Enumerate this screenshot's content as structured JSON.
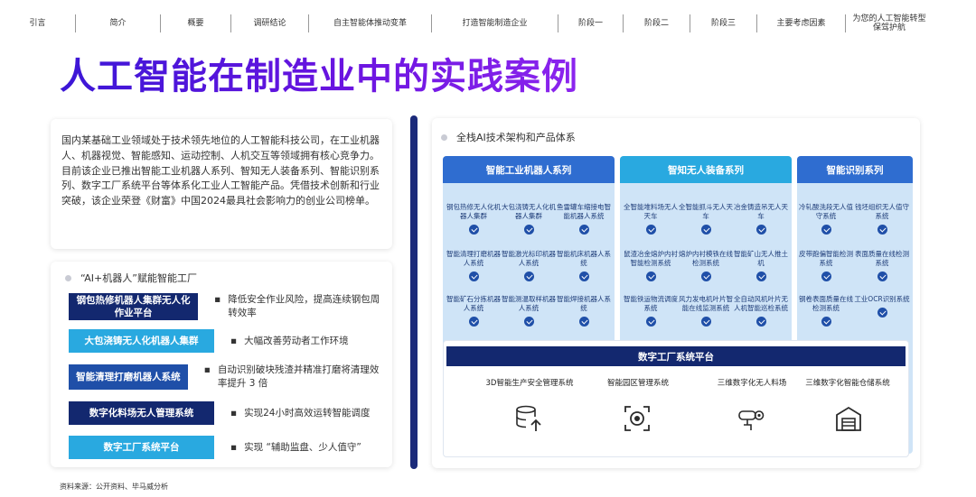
{
  "nav": [
    "引言",
    "简介",
    "概要",
    "调研结论",
    "自主智能体推动变革",
    "打造智能制造企业",
    "阶段一",
    "阶段二",
    "阶段三",
    "主要考虑因素",
    "为您的人工智能转型保驾护航"
  ],
  "title": "人工智能在制造业中的实践案例",
  "intro": "国内某基础工业领域处于技术领先地位的人工智能科技公司，在工业机器人、机器视觉、智能感知、运动控制、人机交互等领域拥有核心竞争力。目前该企业已推出智能工业机器人系列、智知无人装备系列、智能识别系列、数字工厂系统平台等体系化工业人工智能产品。凭借技术创新和行业突破，该企业荣登《财富》中国2024最具社会影响力的创业公司榜单。",
  "factory": {
    "heading": "“AI+机器人”赋能智能工厂",
    "rows": [
      {
        "label": "钢包热修机器人集群无人化作业平台",
        "desc": "降低安全作业风险，提高连续钢包周转效率",
        "color": "#13286f"
      },
      {
        "label": "大包浇铸无人化机器人集群",
        "desc": "大幅改善劳动者工作环境",
        "color": "#29a9e0"
      },
      {
        "label": "智能清理打磨机器人系统",
        "desc": "自动识别破块残渣并精准打磨将清理效率提升 3 倍",
        "color": "#1f4fa8"
      },
      {
        "label": "数字化料场无人管理系统",
        "desc": "实现24小时高效运转智能调度",
        "color": "#13286f"
      },
      {
        "label": "数字工厂系统平台",
        "desc": "实现 “辅助监盘、少人值守”",
        "color": "#29a9e0"
      }
    ]
  },
  "arch": {
    "heading": "全栈AI技术架构和产品体系",
    "panels": [
      {
        "title": "智能工业机器人系列",
        "color": "#2f6dd0",
        "items": [
          "钢包热修无人化机器人集群",
          "大包浇铸无人化机器人集群",
          "鱼雷罐车缩接电智能机器人系统",
          "智能清理打磨机器人系统",
          "智能激光标印机器人系统",
          "智能机床机器人系统",
          "智能矿石分拣机器人系统",
          "智能测温取样机器人系统",
          "智能焊接机器人系统"
        ]
      },
      {
        "title": "智知无人装备系列",
        "color": "#29a9e0",
        "items": [
          "全智能堆料场无人天车",
          "全智能抓斗无人天车",
          "冶金铸造吊无人天车",
          "鼠渣冶金熔炉内衬智能检测系统",
          "熔炉内衬模铁在线检测系统",
          "智能矿山无人推土机",
          "智能铁运物流调度系统",
          "风力发电机叶片智能在线监测系统",
          "全自动风机叶片无人机智能巡检系统"
        ]
      },
      {
        "title": "智能识别系列",
        "color": "#2f6dd0",
        "items": [
          "冷轧酸洗段无人值守系统",
          "钱坯组织无人值守系统",
          "皮带跑偏智能检测系统",
          "表面质量在线检测系统",
          "钢卷表面质量在线检测系统",
          "工业OCR识别系统"
        ]
      }
    ],
    "platform": {
      "title": "数字工厂系统平台",
      "items": [
        "3D智能生产安全管理系统",
        "智能园区管理系统",
        "三维数字化无人料场",
        "三维数字化智能仓储系统"
      ]
    }
  },
  "source": "资料来源：公开资料、毕马威分析"
}
